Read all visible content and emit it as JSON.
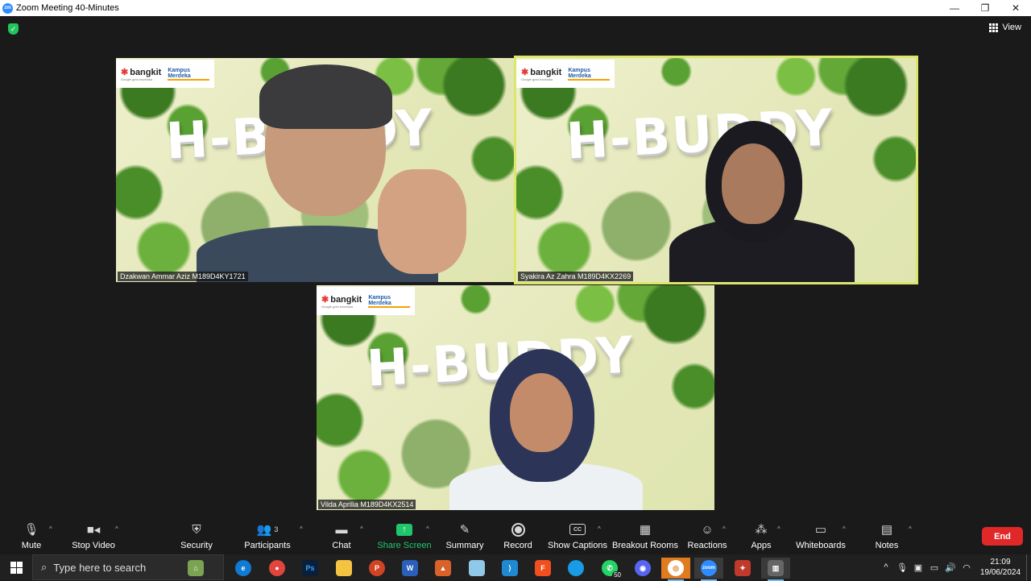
{
  "window": {
    "title": "Zoom Meeting 40-Minutes",
    "app_icon": "zoom-icon",
    "app_icon_text": "zm",
    "minimize": "—",
    "restore": "❐",
    "close": "✕"
  },
  "stage": {
    "view_label": "View",
    "participants": [
      {
        "name": "Dzakwan Ammar Aziz  M189D4KY1721",
        "active_speaker": false
      },
      {
        "name": "Syakira Az Zahra M189D4KX2269",
        "active_speaker": true
      },
      {
        "name": "Vilda Aprilia M189D4KX2514",
        "active_speaker": false
      }
    ],
    "background_text": "H-BUDDY",
    "logo_bangkit": "bangkit",
    "logo_partners": "Google  goto  traveloka",
    "logo_kampus": "Kampus Merdeka"
  },
  "controls": {
    "mute": "Mute",
    "stop_video": "Stop Video",
    "security": "Security",
    "participants": "Participants",
    "participants_count": "3",
    "chat": "Chat",
    "share_screen": "Share Screen",
    "summary": "Summary",
    "record": "Record",
    "show_captions": "Show Captions",
    "cc_text": "CC",
    "breakout_rooms": "Breakout Rooms",
    "reactions": "Reactions",
    "apps": "Apps",
    "whiteboards": "Whiteboards",
    "notes": "Notes",
    "end": "End",
    "colors": {
      "share_green": "#1fc66b",
      "end_red": "#e02828",
      "active_outline": "#dce66b"
    }
  },
  "taskbar": {
    "search_placeholder": "Type here to search",
    "whatsapp_badge": "50",
    "time": "21:09",
    "date": "19/06/2024"
  }
}
